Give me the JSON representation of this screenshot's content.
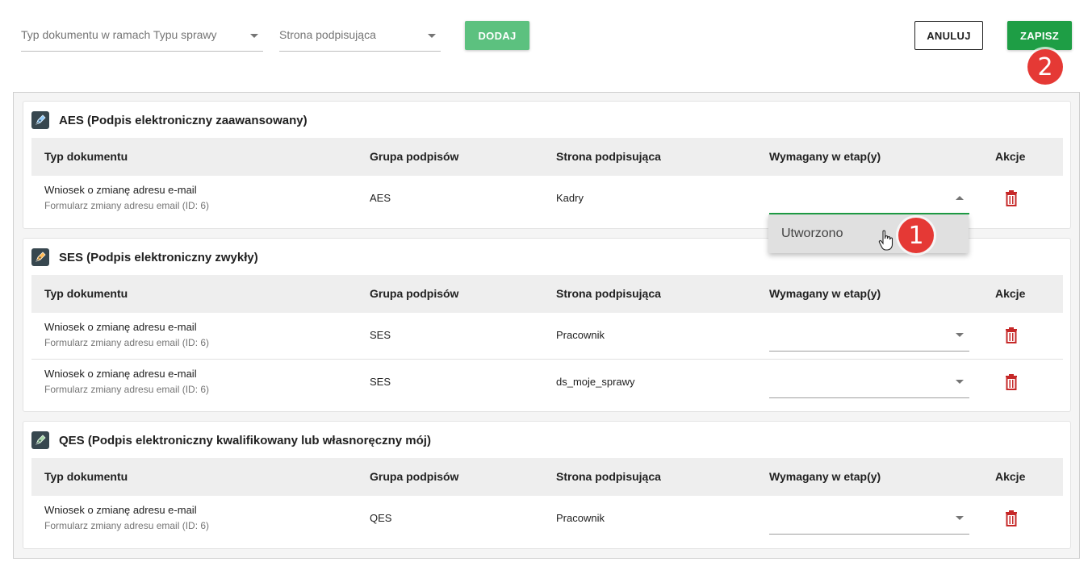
{
  "toolbar": {
    "doc_type_placeholder": "Typ dokumentu w ramach Typu sprawy",
    "party_placeholder": "Strona podpisująca",
    "add_label": "DODAJ",
    "cancel_label": "ANULUJ",
    "save_label": "ZAPISZ"
  },
  "badges": {
    "step1": "1",
    "step2": "2"
  },
  "columns": {
    "doc_type": "Typ dokumentu",
    "group": "Grupa podpisów",
    "party": "Strona podpisująca",
    "stage": "Wymagany w etap(y)",
    "actions": "Akcje"
  },
  "sections": [
    {
      "title": "AES (Podpis elektroniczny zaawansowany)",
      "icon": "pen-nib-blue-icon",
      "rows": [
        {
          "doc": "Wniosek o zmianę adresu e-mail",
          "sub": "Formularz zmiany adresu email (ID: 6)",
          "group": "AES",
          "party": "Kadry"
        }
      ]
    },
    {
      "title": "SES (Podpis elektroniczny zwykły)",
      "icon": "pen-nib-orange-icon",
      "rows": [
        {
          "doc": "Wniosek o zmianę adresu e-mail",
          "sub": "Formularz zmiany adresu email (ID: 6)",
          "group": "SES",
          "party": "Pracownik"
        },
        {
          "doc": "Wniosek o zmianę adresu e-mail",
          "sub": "Formularz zmiany adresu email (ID: 6)",
          "group": "SES",
          "party": "ds_moje_sprawy"
        }
      ]
    },
    {
      "title": "QES (Podpis elektroniczny kwalifikowany lub własnoręczny mój)",
      "icon": "pen-nib-green-icon",
      "rows": [
        {
          "doc": "Wniosek o zmianę adresu e-mail",
          "sub": "Formularz zmiany adresu email (ID: 6)",
          "group": "QES",
          "party": "Pracownik"
        }
      ]
    }
  ],
  "dropdown": {
    "options": [
      "Utworzono"
    ]
  },
  "colors": {
    "primary": "#1e9e45",
    "add_button": "#5cc17f",
    "delete": "#c62828",
    "badge": "#e53935"
  }
}
